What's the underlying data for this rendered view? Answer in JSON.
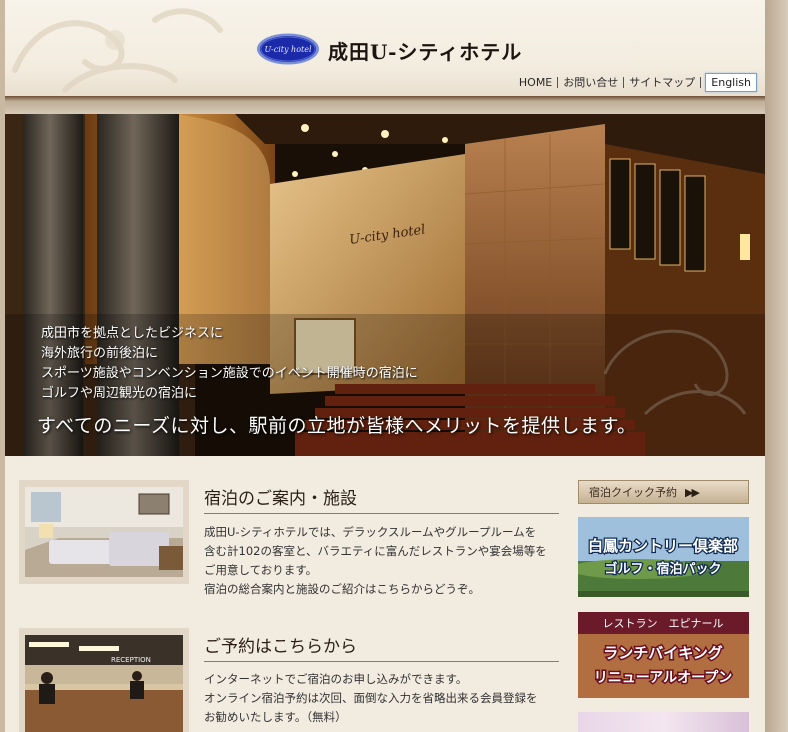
{
  "header": {
    "logo_text": "U-city hotel",
    "hotel_name": "成田U-シティホテル",
    "nav": [
      {
        "label": "HOME"
      },
      {
        "label": "お問い合せ"
      },
      {
        "label": "サイトマップ"
      }
    ],
    "english_label": "English"
  },
  "hero": {
    "sign_text": "U-city hotel",
    "lines": [
      "成田市を拠点としたビジネスに",
      "海外旅行の前後泊に",
      "スポーツ施設やコンベンション施設でのイベント開催時の宿泊に",
      "ゴルフや周辺観光の宿泊に"
    ],
    "tagline": "すべてのニーズに対し、駅前の立地が皆様へメリットを提供します。"
  },
  "sections": [
    {
      "title": "宿泊のご案内・施設",
      "body": [
        "成田U-シティホテルでは、デラックスルームやグループルームを",
        "含む計102の客室と、バラエティに富んだレストランや宴会場等を",
        "ご用意しております。",
        "宿泊の総合案内と施設のご紹介はこちらからどうぞ。"
      ]
    },
    {
      "title": "ご予約はこちらから",
      "reception_sign": "RECEPTION",
      "body": [
        "インターネットでご宿泊のお申し込みができます。",
        "オンライン宿泊予約は次回、面倒な入力を省略出来る会員登録を",
        "お勧めいたします。（無料）"
      ]
    }
  ],
  "sidebar": {
    "quick_booking_label": "宿泊クイック予約",
    "quick_booking_arrows": "▶▶",
    "golf_banner": {
      "line1": "白鳳カントリー倶楽部",
      "line2": "ゴルフ・宿泊パック"
    },
    "restaurant_banner": {
      "top": "レストラン　エピナール",
      "line1": "ランチバイキング",
      "line2": "リニューアルオープン"
    }
  },
  "colors": {
    "page_bg": "#f2ebe0",
    "header_band": "#6d4e33",
    "accent_brown": "#8a6a48"
  }
}
